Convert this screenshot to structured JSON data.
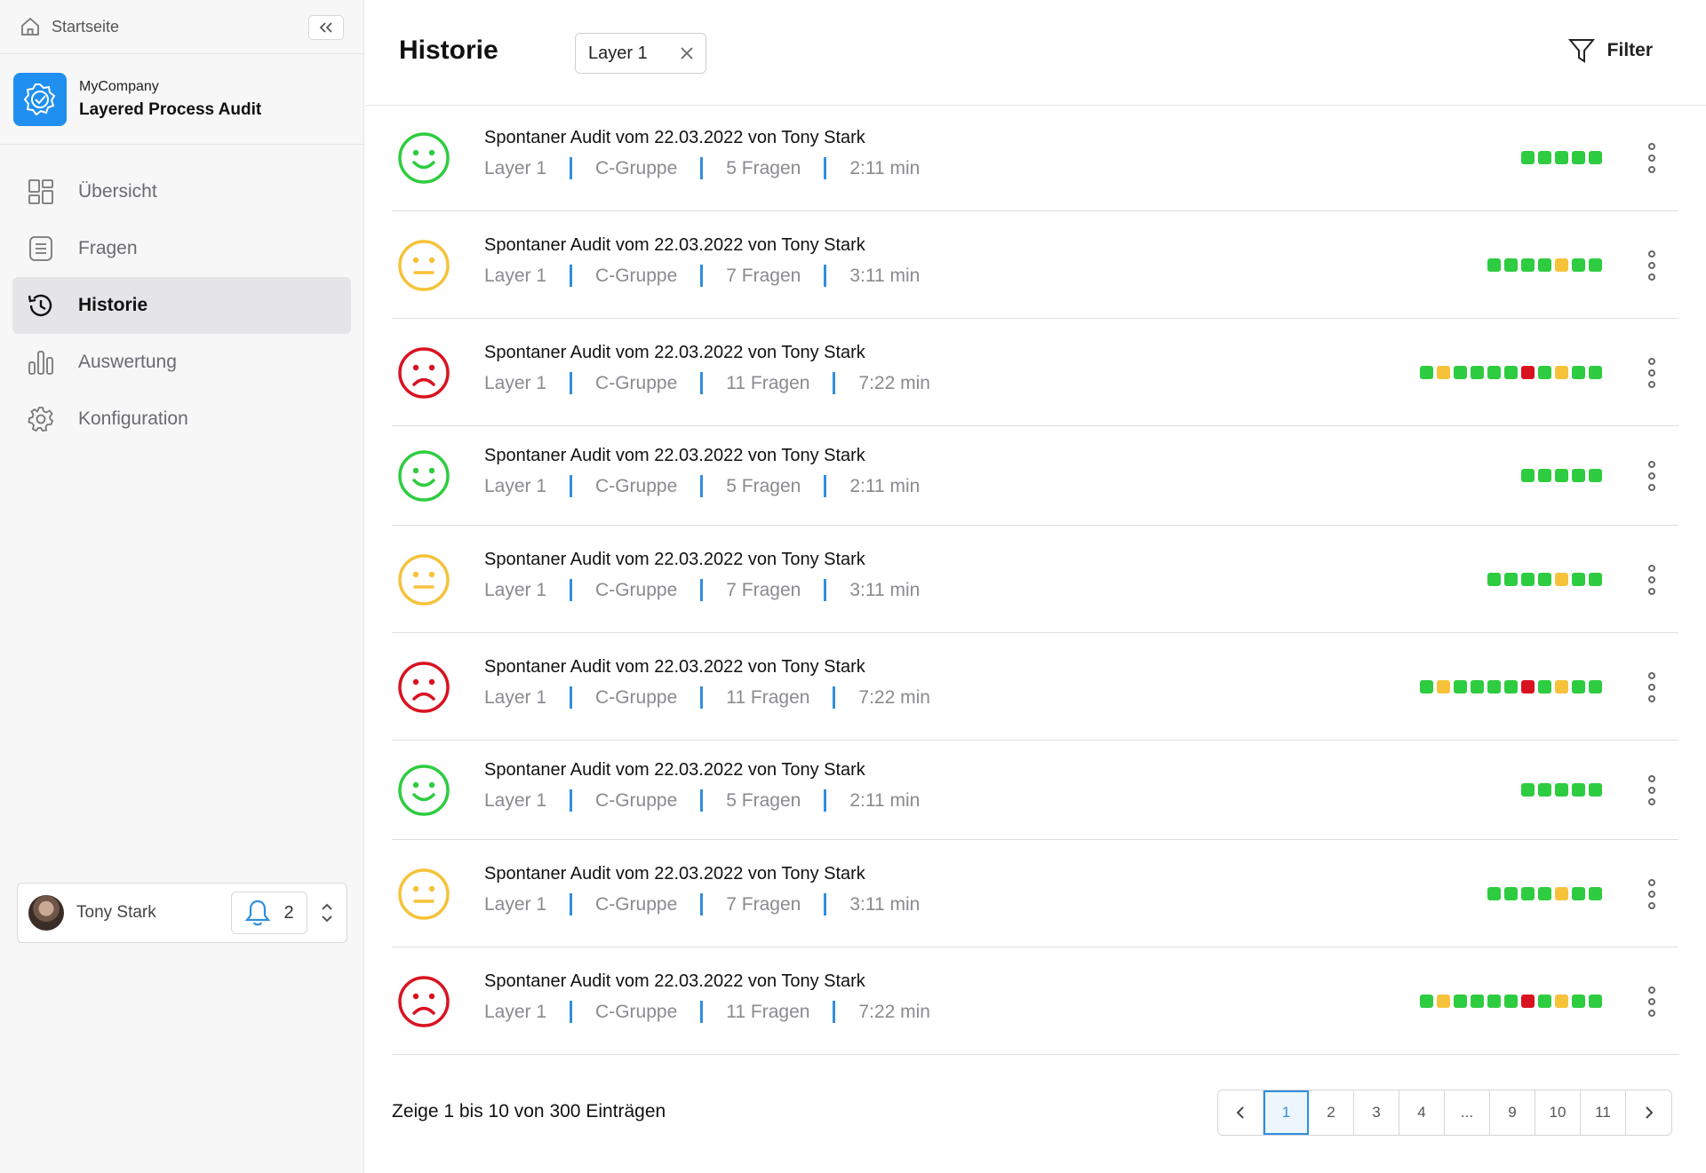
{
  "sidebar": {
    "home_label": "Startseite",
    "company": "MyCompany",
    "app_name": "Layered Process Audit",
    "nav": [
      {
        "label": "Übersicht",
        "icon": "grid-icon"
      },
      {
        "label": "Fragen",
        "icon": "list-icon"
      },
      {
        "label": "Historie",
        "icon": "history-icon",
        "active": true
      },
      {
        "label": "Auswertung",
        "icon": "bar-chart-icon"
      },
      {
        "label": "Konfiguration",
        "icon": "gear-icon"
      }
    ],
    "user": {
      "name": "Tony Stark",
      "notifications": "2"
    }
  },
  "header": {
    "title": "Historie",
    "chip_label": "Layer 1",
    "filter_label": "Filter"
  },
  "colors": {
    "green": "#2ecc40",
    "yellow": "#f5c23a",
    "red": "#d9121f",
    "accent": "#2f8fdf"
  },
  "rows": [
    {
      "title": "Spontaner Audit vom 22.03.2022 von Tony Stark",
      "layer": "Layer 1",
      "group": "C-Gruppe",
      "questions": "5 Fragen",
      "duration": "2:11 min",
      "mood": "happy",
      "scores": [
        "g",
        "g",
        "g",
        "g",
        "g"
      ]
    },
    {
      "title": "Spontaner Audit vom 22.03.2022 von Tony Stark",
      "layer": "Layer 1",
      "group": "C-Gruppe",
      "questions": "7 Fragen",
      "duration": "3:11 min",
      "mood": "neutral",
      "scores": [
        "g",
        "g",
        "g",
        "g",
        "y",
        "g",
        "g"
      ]
    },
    {
      "title": "Spontaner Audit vom 22.03.2022 von Tony Stark",
      "layer": "Layer 1",
      "group": "C-Gruppe",
      "questions": "11 Fragen",
      "duration": "7:22 min",
      "mood": "sad",
      "scores": [
        "g",
        "y",
        "g",
        "g",
        "g",
        "g",
        "r",
        "g",
        "y",
        "g",
        "g"
      ]
    },
    {
      "title": "Spontaner Audit vom 22.03.2022 von Tony Stark",
      "layer": "Layer 1",
      "group": "C-Gruppe",
      "questions": "5 Fragen",
      "duration": "2:11 min",
      "mood": "happy",
      "scores": [
        "g",
        "g",
        "g",
        "g",
        "g"
      ]
    },
    {
      "title": "Spontaner Audit vom 22.03.2022 von Tony Stark",
      "layer": "Layer 1",
      "group": "C-Gruppe",
      "questions": "7 Fragen",
      "duration": "3:11 min",
      "mood": "neutral",
      "scores": [
        "g",
        "g",
        "g",
        "g",
        "y",
        "g",
        "g"
      ]
    },
    {
      "title": "Spontaner Audit vom 22.03.2022 von Tony Stark",
      "layer": "Layer 1",
      "group": "C-Gruppe",
      "questions": "11 Fragen",
      "duration": "7:22 min",
      "mood": "sad",
      "scores": [
        "g",
        "y",
        "g",
        "g",
        "g",
        "g",
        "r",
        "g",
        "y",
        "g",
        "g"
      ]
    },
    {
      "title": "Spontaner Audit vom 22.03.2022 von Tony Stark",
      "layer": "Layer 1",
      "group": "C-Gruppe",
      "questions": "5 Fragen",
      "duration": "2:11 min",
      "mood": "happy",
      "scores": [
        "g",
        "g",
        "g",
        "g",
        "g"
      ]
    },
    {
      "title": "Spontaner Audit vom 22.03.2022 von Tony Stark",
      "layer": "Layer 1",
      "group": "C-Gruppe",
      "questions": "7 Fragen",
      "duration": "3:11 min",
      "mood": "neutral",
      "scores": [
        "g",
        "g",
        "g",
        "g",
        "y",
        "g",
        "g"
      ]
    },
    {
      "title": "Spontaner Audit vom 22.03.2022 von Tony Stark",
      "layer": "Layer 1",
      "group": "C-Gruppe",
      "questions": "11 Fragen",
      "duration": "7:22 min",
      "mood": "sad",
      "scores": [
        "g",
        "y",
        "g",
        "g",
        "g",
        "g",
        "r",
        "g",
        "y",
        "g",
        "g"
      ]
    }
  ],
  "footer": {
    "summary": "Zeige 1 bis 10 von 300 Einträgen",
    "pages": [
      "1",
      "2",
      "3",
      "4",
      "...",
      "9",
      "10",
      "11"
    ],
    "current_page": "1"
  }
}
